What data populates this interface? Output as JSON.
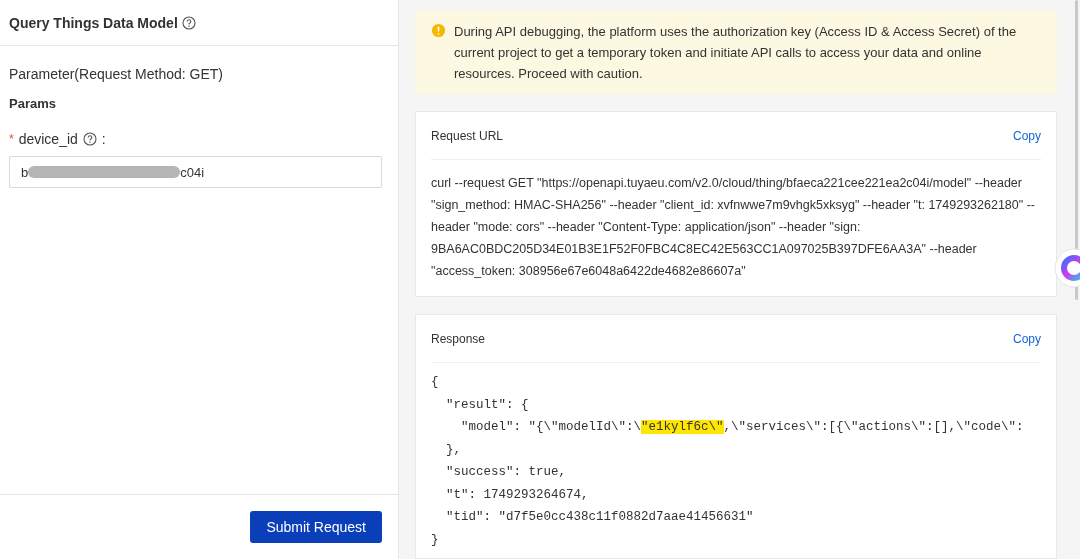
{
  "left_panel": {
    "title": "Query Things Data Model",
    "section_title": "Parameter(Request Method: GET)",
    "params_heading": "Params",
    "fields": [
      {
        "label": "device_id",
        "required_mark": "*",
        "suffix": ":",
        "value_start": "b",
        "value_end": "c04i",
        "redacted": true
      }
    ],
    "submit_button": "Submit Request"
  },
  "alert": {
    "text": "During API debugging, the platform uses the authorization key (Access ID & Access Secret) of the current project to get a temporary token and initiate API calls to access your data and online resources. Proceed with caution."
  },
  "request_url": {
    "title": "Request URL",
    "copy": "Copy",
    "text": "curl --request GET \"https://openapi.tuyaeu.com/v2.0/cloud/thing/bfaeca221cee221ea2c04i/model\" --header \"sign_method: HMAC-SHA256\" --header \"client_id: xvfnwwe7m9vhgk5xksyg\" --header \"t: 1749293262180\" --header \"mode: cors\" --header \"Content-Type: application/json\" --header \"sign: 9BA6AC0BDC205D34E01B3E1F52F0FBC4C8EC42E563CC1A097025B397DFE6AA3A\" --header \"access_token: 308956e67e6048a6422de4682e86607a\""
  },
  "response": {
    "title": "Response",
    "copy": "Copy",
    "lines": [
      [
        {
          "text": "{",
          "highlighted": false
        }
      ],
      [
        {
          "text": "  \"result\": {",
          "highlighted": false
        }
      ],
      [
        {
          "text": "    \"model\": \"{\\\"modelId\\\":\\",
          "highlighted": false
        },
        {
          "text": "\"e1kylf6c\\\"",
          "highlighted": true
        },
        {
          "text": ",\\\"services\\\":[{\\\"actions\\\":[],\\\"code\\\":",
          "highlighted": false
        }
      ],
      [
        {
          "text": "  },",
          "highlighted": false
        }
      ],
      [
        {
          "text": "  \"success\": true,",
          "highlighted": false
        }
      ],
      [
        {
          "text": "  \"t\": 1749293264674,",
          "highlighted": false
        }
      ],
      [
        {
          "text": "  \"tid\": \"d7f5e0cc438c11f0882d7aae41456631\"",
          "highlighted": false
        }
      ],
      [
        {
          "text": "}",
          "highlighted": false
        }
      ]
    ]
  }
}
